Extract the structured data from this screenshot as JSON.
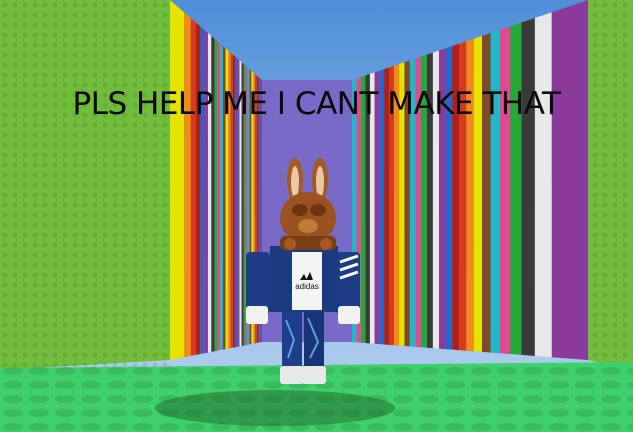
{
  "caption": {
    "text": "PLS HELP ME I CANT MAKE THAT"
  },
  "character": {
    "shirt_text": "adidas"
  },
  "colors": {
    "sky": "#6ea8e0",
    "grass": "#6fb93c",
    "floor": "#3dcd6a",
    "stripes": [
      "#e8e200",
      "#f08b18",
      "#d63b1e",
      "#b0201a",
      "#2a64c8",
      "#8a3a9a",
      "#e8e8e8",
      "#3a3a3a",
      "#25a838",
      "#e04a90",
      "#1fb8c8",
      "#7a4a2a"
    ]
  }
}
